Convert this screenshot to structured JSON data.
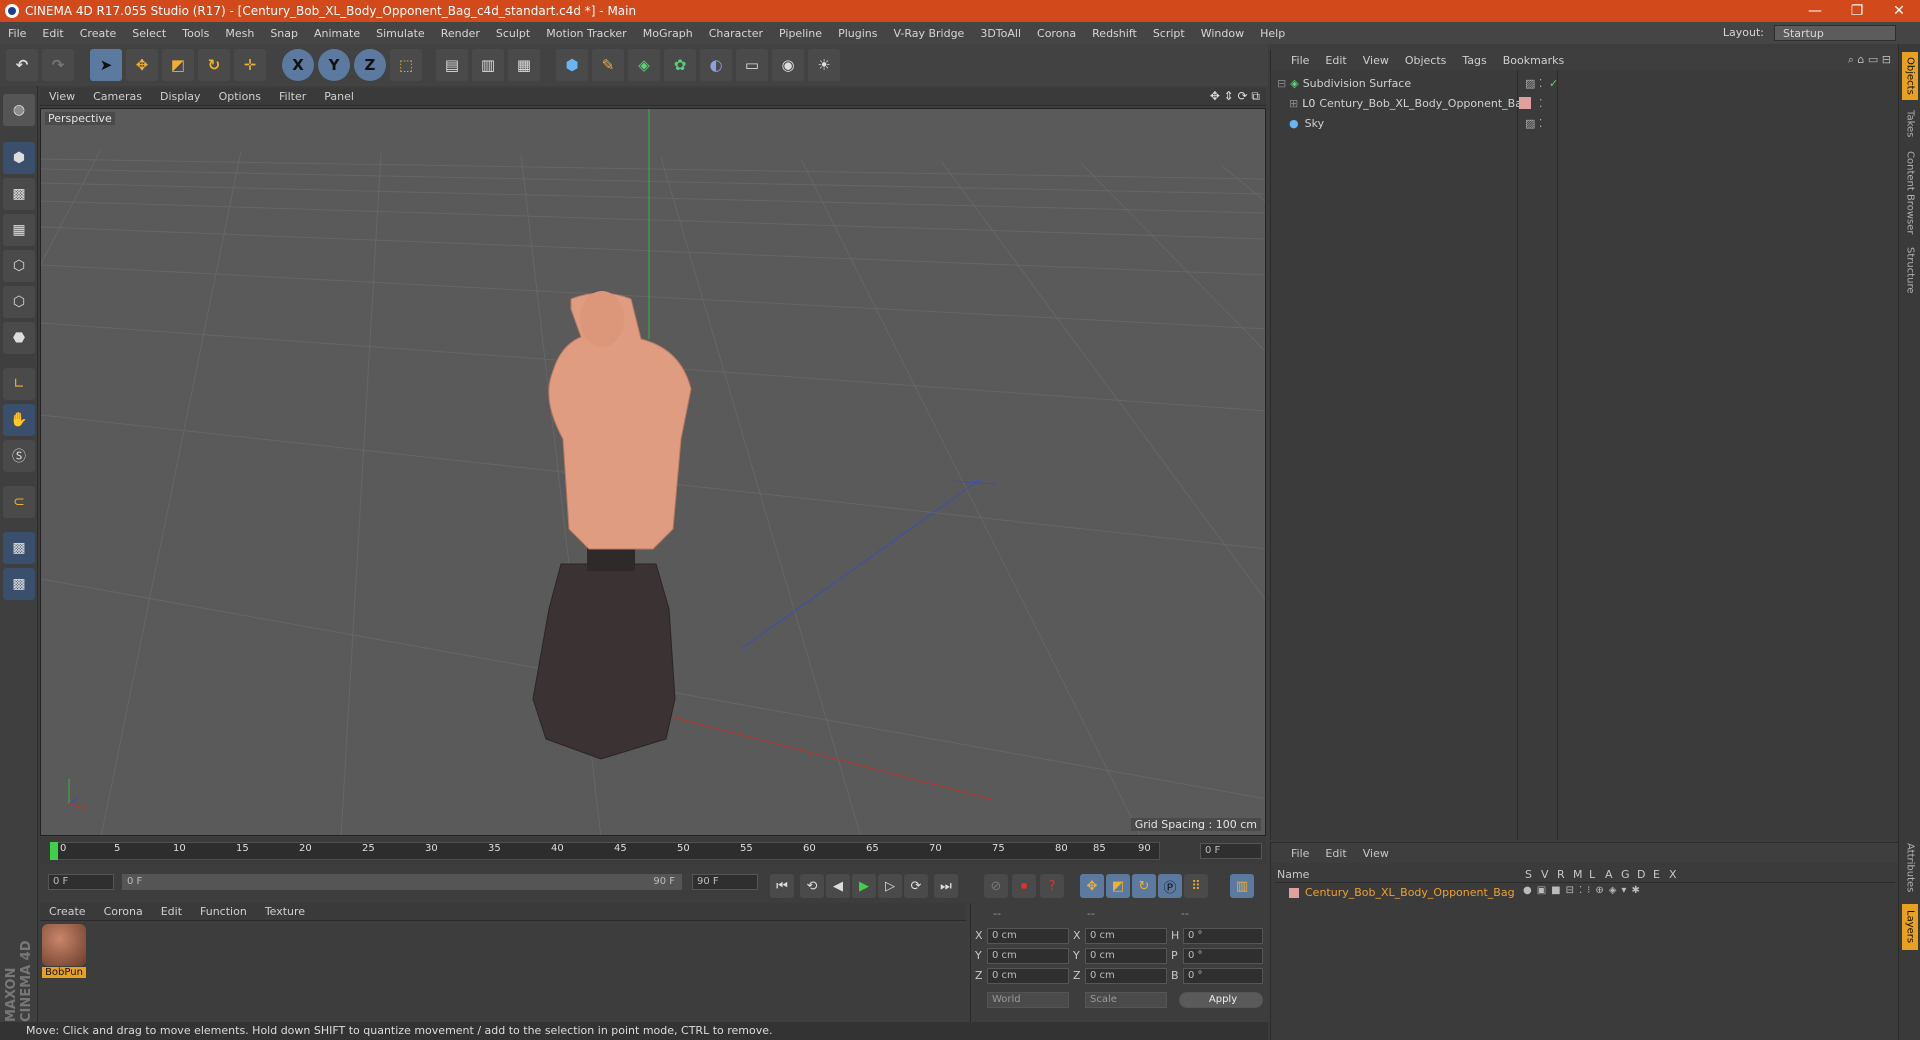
{
  "window": {
    "title": "CINEMA 4D R17.055 Studio (R17) - [Century_Bob_XL_Body_Opponent_Bag_c4d_standart.c4d *] - Main",
    "minimize": "—",
    "restore": "❐",
    "close": "✕"
  },
  "menu": {
    "items": [
      "File",
      "Edit",
      "Create",
      "Select",
      "Tools",
      "Mesh",
      "Snap",
      "Animate",
      "Simulate",
      "Render",
      "Sculpt",
      "Motion Tracker",
      "MoGraph",
      "Character",
      "Pipeline",
      "Plugins",
      "V-Ray Bridge",
      "3DToAll",
      "Corona",
      "Redshift",
      "Script",
      "Window",
      "Help"
    ],
    "layout_label": "Layout:",
    "layout_value": "Startup"
  },
  "toolbar": {
    "axis_x": "X",
    "axis_y": "Y",
    "axis_z": "Z"
  },
  "viewport": {
    "menu": [
      "View",
      "Cameras",
      "Display",
      "Options",
      "Filter",
      "Panel"
    ],
    "label": "Perspective",
    "grid_spacing": "Grid Spacing : 100 cm"
  },
  "timeline": {
    "ticks": [
      "0",
      "5",
      "10",
      "15",
      "20",
      "25",
      "30",
      "35",
      "40",
      "45",
      "50",
      "55",
      "60",
      "65",
      "70",
      "75",
      "80",
      "85",
      "90"
    ],
    "current_frame": "0 F"
  },
  "controls": {
    "start_frame": "0 F",
    "range_start": "0 F",
    "range_end": "90 F",
    "end_frame": "90 F"
  },
  "materials": {
    "menu": [
      "Create",
      "Corona",
      "Edit",
      "Function",
      "Texture"
    ],
    "items": [
      {
        "name": "BobPun"
      }
    ]
  },
  "coords": {
    "header": [
      "--",
      "--",
      "--"
    ],
    "rows": [
      {
        "a_label": "X",
        "a_val": "0 cm",
        "b_label": "X",
        "b_val": "0 cm",
        "c_label": "H",
        "c_val": "0 °"
      },
      {
        "a_label": "Y",
        "a_val": "0 cm",
        "b_label": "Y",
        "b_val": "0 cm",
        "c_label": "P",
        "c_val": "0 °"
      },
      {
        "a_label": "Z",
        "a_val": "0 cm",
        "b_label": "Z",
        "b_val": "0 cm",
        "c_label": "B",
        "c_val": "0 °"
      }
    ],
    "mode1": "World",
    "mode2": "Scale",
    "apply": "Apply"
  },
  "status": "Move: Click and drag to move elements. Hold down SHIFT to quantize movement / add to the selection in point mode, CTRL to remove.",
  "objects": {
    "menu": [
      "File",
      "Edit",
      "View",
      "Objects",
      "Tags",
      "Bookmarks"
    ],
    "items": [
      {
        "name": "Subdivision Surface"
      },
      {
        "name": "Century_Bob_XL_Body_Opponent_Bag"
      },
      {
        "name": "Sky"
      }
    ]
  },
  "layers": {
    "menu": [
      "File",
      "Edit",
      "View"
    ],
    "col_name": "Name",
    "cols": [
      "S",
      "V",
      "R",
      "M",
      "L",
      "A",
      "G",
      "D",
      "E",
      "X"
    ],
    "items": [
      {
        "name": "Century_Bob_XL_Body_Opponent_Bag",
        "color": "#e0a0a0"
      }
    ]
  },
  "right_tabs": [
    "Objects",
    "Takes",
    "Content Browser",
    "Structure",
    "Attributes",
    "Layers"
  ],
  "brand": "MAXON CINEMA 4D",
  "colors": {
    "accent": "#d24a1b",
    "skin": "#df9c80",
    "bag": "#3b3333"
  }
}
